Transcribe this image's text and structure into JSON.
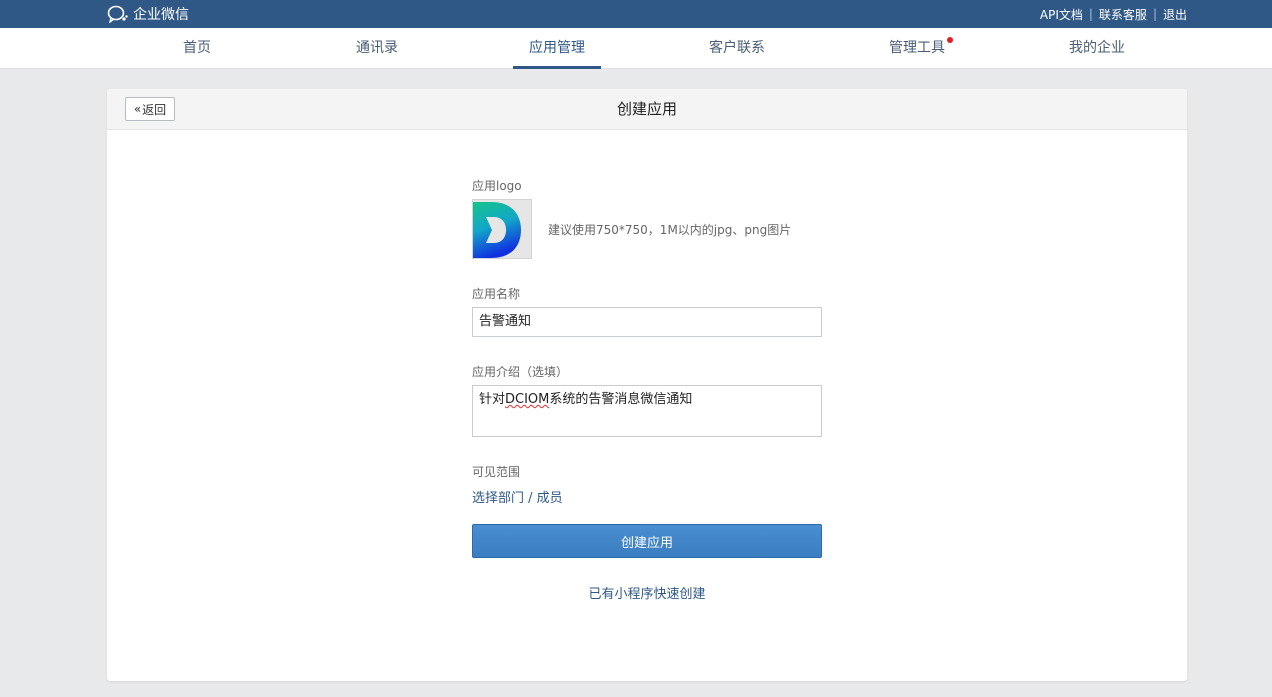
{
  "topbar": {
    "brand": "企业微信",
    "links": [
      "API文档",
      "联系客服",
      "退出"
    ]
  },
  "nav": {
    "items": [
      "首页",
      "通讯录",
      "应用管理",
      "客户联系",
      "管理工具",
      "我的企业"
    ],
    "active": "应用管理"
  },
  "card": {
    "back_label": "返回",
    "title": "创建应用"
  },
  "form": {
    "logo_label": "应用logo",
    "logo_hint": "建议使用750*750，1M以内的jpg、png图片",
    "name_label": "应用名称",
    "name_value": "告警通知",
    "intro_label": "应用介绍（选填）",
    "intro_prefix": "针对",
    "intro_highlight": "DCIOM",
    "intro_suffix": "系统的告警消息微信通知",
    "scope_label": "可见范围",
    "scope_link": "选择部门 / 成员",
    "submit_label": "创建应用",
    "mini_program_link": "已有小程序快速创建"
  },
  "colors": {
    "topbar": "#2f5886",
    "accent": "#2f5886",
    "primary_button": "#3a7dc0",
    "notification_dot": "#e02020"
  }
}
